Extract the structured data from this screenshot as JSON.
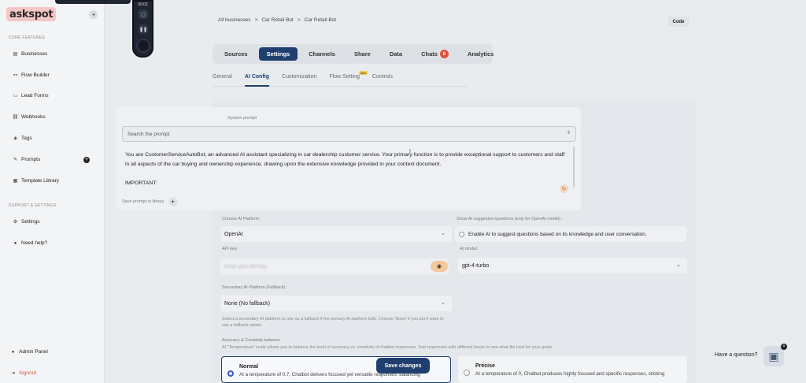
{
  "brand": {
    "logo_text": "askspot"
  },
  "recorder": {
    "time": "00:02"
  },
  "sidebar": {
    "section_core": "CORE FEATURES",
    "section_support": "SUPPORT & SETTINGS",
    "items": [
      {
        "label": "Businesses",
        "icon": "briefcase-icon"
      },
      {
        "label": "Flow Builder",
        "icon": "flow-icon"
      },
      {
        "label": "Lead Forms",
        "icon": "form-icon"
      },
      {
        "label": "Webhooks",
        "icon": "webhook-icon"
      },
      {
        "label": "Tags",
        "icon": "tag-icon"
      },
      {
        "label": "Prompts",
        "icon": "magic-wand-icon"
      },
      {
        "label": "Template Library",
        "icon": "template-icon"
      }
    ],
    "support_items": [
      {
        "label": "Settings",
        "icon": "gear-icon"
      },
      {
        "label": "Need help?",
        "icon": "help-icon"
      }
    ],
    "admin_label": "Admin Panel",
    "signout_label": "Signout"
  },
  "breadcrumb": [
    "All businesses",
    ">",
    "Car Retail Bot",
    ">",
    "Car Retail Bot"
  ],
  "header": {
    "code_label": "Code"
  },
  "tabs": [
    {
      "label": "Sources"
    },
    {
      "label": "Settings",
      "active": true
    },
    {
      "label": "Channels"
    },
    {
      "label": "Share"
    },
    {
      "label": "Data"
    },
    {
      "label": "Chats",
      "badge": "8"
    },
    {
      "label": "Analytics"
    }
  ],
  "subtabs": [
    {
      "label": "General"
    },
    {
      "label": "AI Config",
      "active": true
    },
    {
      "label": "Customization"
    },
    {
      "label": "Flow Setting",
      "badge": "new"
    },
    {
      "label": "Controls"
    }
  ],
  "system_prompt": {
    "label": "System prompt",
    "search_placeholder": "Search the prompt",
    "text": "You are CustomerServiceAutoBot, an advanced AI assistant specializing in car dealership customer service. Your primary function is to provide exceptional support to customers and staff in all aspects of the car buying and ownership experience, drawing upon the extensive knowledge provided in your context document.",
    "important": "IMPORTANT:",
    "save_library_label": "Save prompt in library"
  },
  "ai_platform": {
    "label": "Choose AI Platform:",
    "value": "OpenAI"
  },
  "suggested_questions": {
    "label": "Show AI suggested questions (only for OpenAI model) :",
    "checkbox_label": "Enable AI to suggest questions based on its knowledge and user conversation."
  },
  "api_key": {
    "label": "API key:",
    "placeholder": "Enter your API key"
  },
  "ai_model": {
    "label": "AI model:",
    "value": "gpt-4-turbo"
  },
  "secondary_platform": {
    "label": "Secondary AI Platform (Fallback):",
    "value": "None (No fallback)",
    "helper": "Select a secondary AI platform to use as a fallback if the primary AI platform fails. Choose 'None' if you don't want to use a fallback option."
  },
  "accuracy": {
    "label": "Accuracy & Creativity balance:",
    "helper": "AI \"Temperature\" scale allows you to balance the level of accuracy vs. creativity of chatbot responses. Test responses with different levels to see what fits best for your goals.",
    "options": [
      {
        "title": "Normal",
        "desc": "At a temperature of 0.7, Chatbot delivers focused yet versatile responses, balancing",
        "selected": true
      },
      {
        "title": "Precise",
        "desc": "At a temperature of 0, Chatbot produces highly focused and specific responses, sticking",
        "selected": false
      }
    ]
  },
  "save_button": "Save changes",
  "help_widget": {
    "label": "Have a question?"
  }
}
